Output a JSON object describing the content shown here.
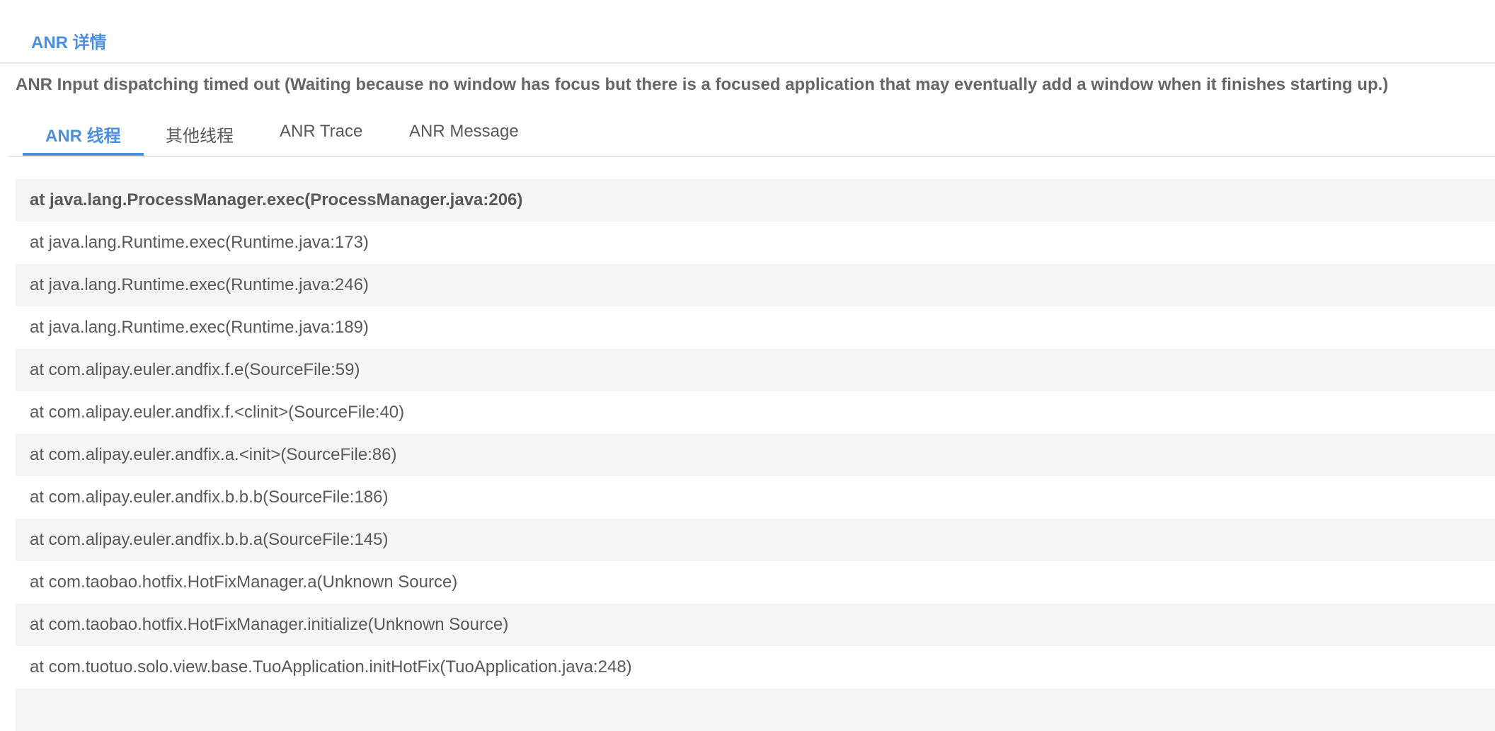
{
  "header": {
    "title": "ANR 详情"
  },
  "reason": "ANR Input dispatching timed out (Waiting because no window has focus but there is a focused application that may eventually add a window when it finishes starting up.)",
  "tabs": [
    {
      "label": "ANR 线程",
      "active": true
    },
    {
      "label": "其他线程",
      "active": false
    },
    {
      "label": "ANR Trace",
      "active": false
    },
    {
      "label": "ANR Message",
      "active": false
    }
  ],
  "stack_lines": [
    "at java.lang.ProcessManager.exec(ProcessManager.java:206)",
    "at java.lang.Runtime.exec(Runtime.java:173)",
    "at java.lang.Runtime.exec(Runtime.java:246)",
    "at java.lang.Runtime.exec(Runtime.java:189)",
    "at com.alipay.euler.andfix.f.e(SourceFile:59)",
    "at com.alipay.euler.andfix.f.<clinit>(SourceFile:40)",
    "at com.alipay.euler.andfix.a.<init>(SourceFile:86)",
    "at com.alipay.euler.andfix.b.b.b(SourceFile:186)",
    "at com.alipay.euler.andfix.b.b.a(SourceFile:145)",
    "at com.taobao.hotfix.HotFixManager.a(Unknown Source)",
    "at com.taobao.hotfix.HotFixManager.initialize(Unknown Source)",
    "at com.tuotuo.solo.view.base.TuoApplication.initHotFix(TuoApplication.java:248)"
  ],
  "colors": {
    "accent": "#4a8fe2",
    "text": "#595959",
    "row_alt": "#f6f5f6",
    "border": "#e8e8e8"
  }
}
